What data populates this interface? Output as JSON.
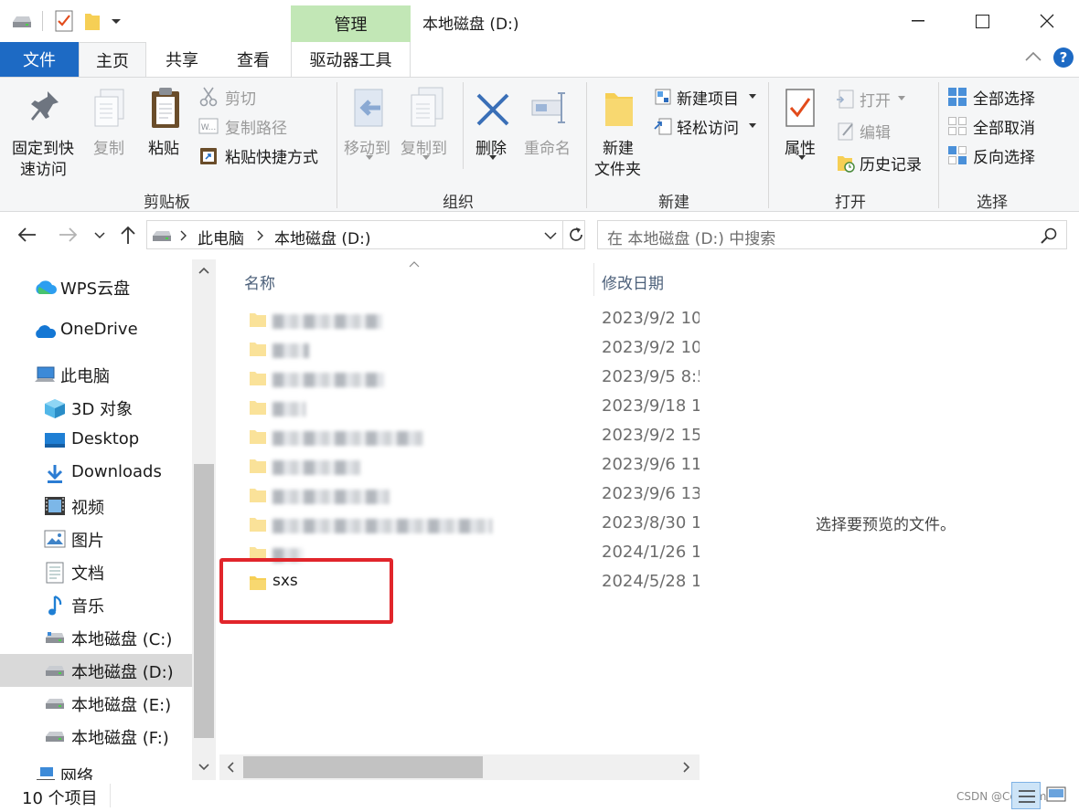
{
  "window": {
    "title": "本地磁盘 (D:)"
  },
  "tabs": {
    "file": "文件",
    "home": "主页",
    "share": "共享",
    "view": "查看",
    "manage_context": "管理",
    "drive_tools": "驱动器工具"
  },
  "ribbon": {
    "clipboard": {
      "pin": [
        "固定到快",
        "速访问"
      ],
      "copy": "复制",
      "paste": "粘贴",
      "cut": "剪切",
      "copy_path": "复制路径",
      "paste_shortcut": "粘贴快捷方式",
      "group": "剪贴板"
    },
    "organize": {
      "move_to": "移动到",
      "copy_to": "复制到",
      "delete": "删除",
      "rename": "重命名",
      "group": "组织"
    },
    "new": {
      "new_folder": [
        "新建",
        "文件夹"
      ],
      "new_item": "新建项目",
      "easy_access": "轻松访问",
      "group": "新建"
    },
    "open": {
      "properties": "属性",
      "open": "打开",
      "edit": "编辑",
      "history": "历史记录",
      "group": "打开"
    },
    "select": {
      "select_all": "全部选择",
      "select_none": "全部取消",
      "invert": "反向选择",
      "group": "选择"
    }
  },
  "address": {
    "crumbs": [
      "此电脑",
      "本地磁盘 (D:)"
    ],
    "search_placeholder": "在 本地磁盘 (D:) 中搜索"
  },
  "sidebar": {
    "items": [
      {
        "label": "WPS云盘",
        "icon": "cloud-icon"
      },
      {
        "label": "OneDrive",
        "icon": "onedrive-icon"
      },
      {
        "label": "此电脑",
        "icon": "computer-icon"
      },
      {
        "label": "3D 对象",
        "icon": "cube-icon"
      },
      {
        "label": "Desktop",
        "icon": "desktop-icon"
      },
      {
        "label": "Downloads",
        "icon": "download-icon"
      },
      {
        "label": "视频",
        "icon": "video-icon"
      },
      {
        "label": "图片",
        "icon": "picture-icon"
      },
      {
        "label": "文档",
        "icon": "document-icon"
      },
      {
        "label": "音乐",
        "icon": "music-icon"
      },
      {
        "label": "本地磁盘 (C:)",
        "icon": "drive-icon"
      },
      {
        "label": "本地磁盘 (D:)",
        "icon": "drive-icon"
      },
      {
        "label": "本地磁盘 (E:)",
        "icon": "drive-icon"
      },
      {
        "label": "本地磁盘 (F:)",
        "icon": "drive-icon"
      },
      {
        "label": "网络",
        "icon": "network-icon"
      }
    ]
  },
  "filelist": {
    "columns": {
      "name": "名称",
      "date": "修改日期"
    },
    "rows": [
      {
        "name": "",
        "date": "2023/9/2 10"
      },
      {
        "name": "",
        "date": "2023/9/2 10"
      },
      {
        "name": "",
        "date": "2023/9/5 8:5"
      },
      {
        "name": "",
        "date": "2023/9/18 1"
      },
      {
        "name": "",
        "date": "2023/9/2 15"
      },
      {
        "name": "",
        "date": "2023/9/6 11"
      },
      {
        "name": "",
        "date": "2023/9/6 13"
      },
      {
        "name": "",
        "date": "2023/8/30 1"
      },
      {
        "name": "",
        "date": "2024/1/26 1"
      },
      {
        "name": "sxs",
        "date": "2024/5/28 1"
      }
    ]
  },
  "preview": {
    "empty_text": "选择要预览的文件。"
  },
  "status": {
    "count": "10 个项目",
    "watermark": "CSDN @Code_mel"
  },
  "colors": {
    "accent": "#1d6ac4",
    "manage_tab": "#c2e7b6",
    "highlight": "#e1252b",
    "folder": "#f6cf55"
  }
}
